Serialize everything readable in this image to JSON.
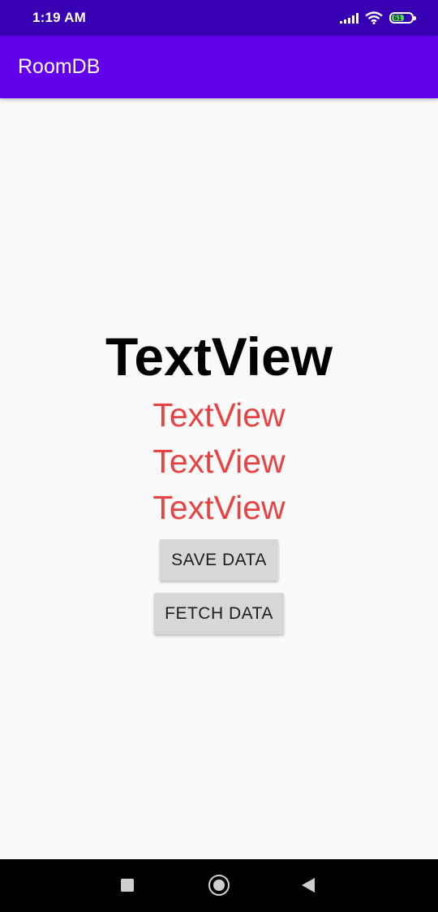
{
  "status_bar": {
    "time": "1:19 AM",
    "battery_level": "61",
    "icons": [
      "signal-icon",
      "wifi-icon",
      "battery-icon"
    ],
    "colors": {
      "background": "#3700b3",
      "battery": "#4cd964"
    }
  },
  "app_bar": {
    "title": "RoomDB",
    "color": "#6200ee"
  },
  "content": {
    "main_text": "TextView",
    "detail_texts": [
      "TextView",
      "TextView",
      "TextView"
    ],
    "detail_color": "#e84343",
    "save_button_label": "SAVE DATA",
    "fetch_button_label": "FETCH DATA"
  },
  "nav_bar": {
    "icons": [
      "recents-icon",
      "home-icon",
      "back-icon"
    ]
  }
}
